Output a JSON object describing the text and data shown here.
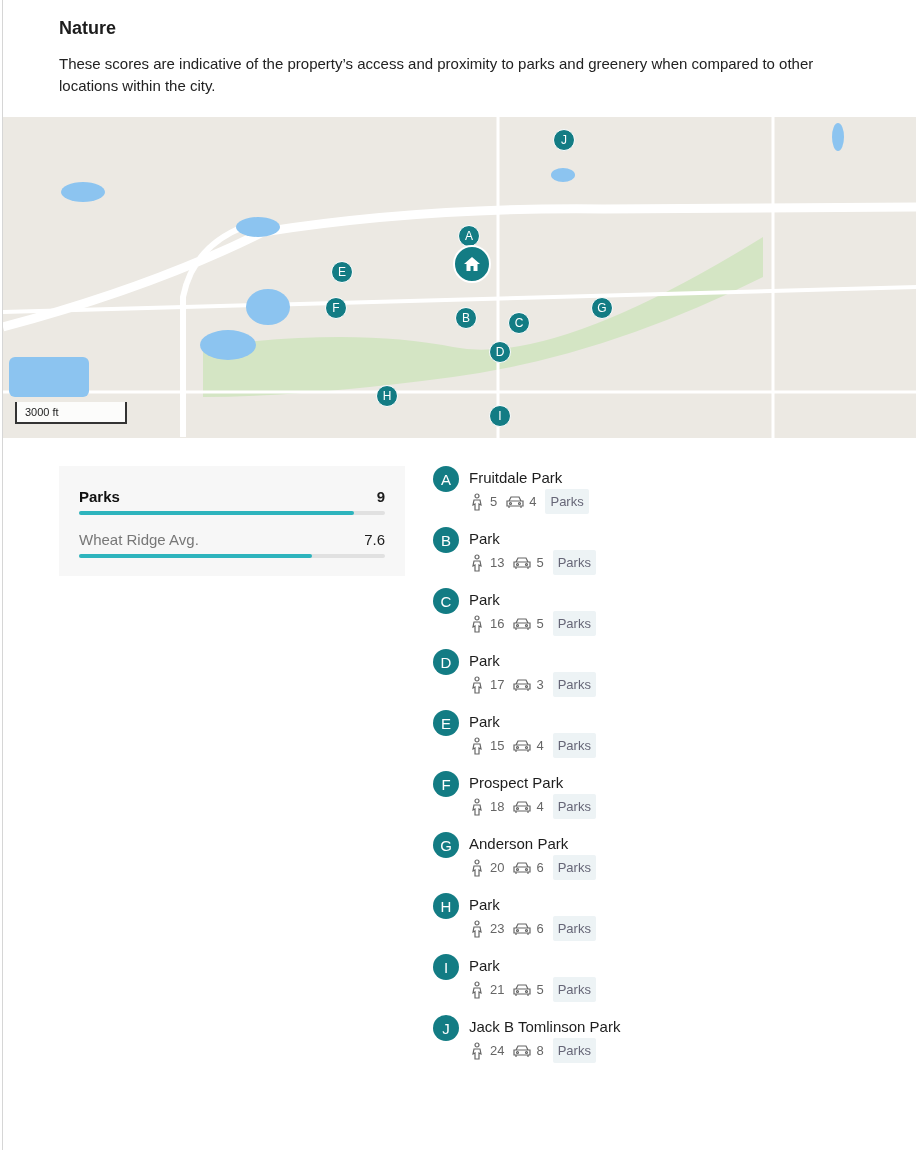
{
  "section": {
    "title": "Nature",
    "description": "These scores are indicative of the property’s access and proximity to parks and greenery when compared to other locations within the city."
  },
  "map": {
    "markers": [
      "A",
      "B",
      "C",
      "D",
      "E",
      "F",
      "G",
      "H",
      "I",
      "J"
    ],
    "scale": "3000 ft"
  },
  "scores": [
    {
      "label": "Parks",
      "value": "9",
      "level": 0.9,
      "primary": true
    },
    {
      "label": "Wheat Ridge Avg.",
      "value": "7.6",
      "level": 0.76,
      "primary": false
    }
  ],
  "places": [
    {
      "marker": "A",
      "name": "Fruitdale Park",
      "walk": "5",
      "drive": "4",
      "tag": "Parks"
    },
    {
      "marker": "B",
      "name": "Park",
      "walk": "13",
      "drive": "5",
      "tag": "Parks"
    },
    {
      "marker": "C",
      "name": "Park",
      "walk": "16",
      "drive": "5",
      "tag": "Parks"
    },
    {
      "marker": "D",
      "name": "Park",
      "walk": "17",
      "drive": "3",
      "tag": "Parks"
    },
    {
      "marker": "E",
      "name": "Park",
      "walk": "15",
      "drive": "4",
      "tag": "Parks"
    },
    {
      "marker": "F",
      "name": "Prospect Park",
      "walk": "18",
      "drive": "4",
      "tag": "Parks"
    },
    {
      "marker": "G",
      "name": "Anderson Park",
      "walk": "20",
      "drive": "6",
      "tag": "Parks"
    },
    {
      "marker": "H",
      "name": "Park",
      "walk": "23",
      "drive": "6",
      "tag": "Parks"
    },
    {
      "marker": "I",
      "name": "Park",
      "walk": "21",
      "drive": "5",
      "tag": "Parks"
    },
    {
      "marker": "J",
      "name": "Jack B Tomlinson Park",
      "walk": "24",
      "drive": "8",
      "tag": "Parks"
    }
  ]
}
